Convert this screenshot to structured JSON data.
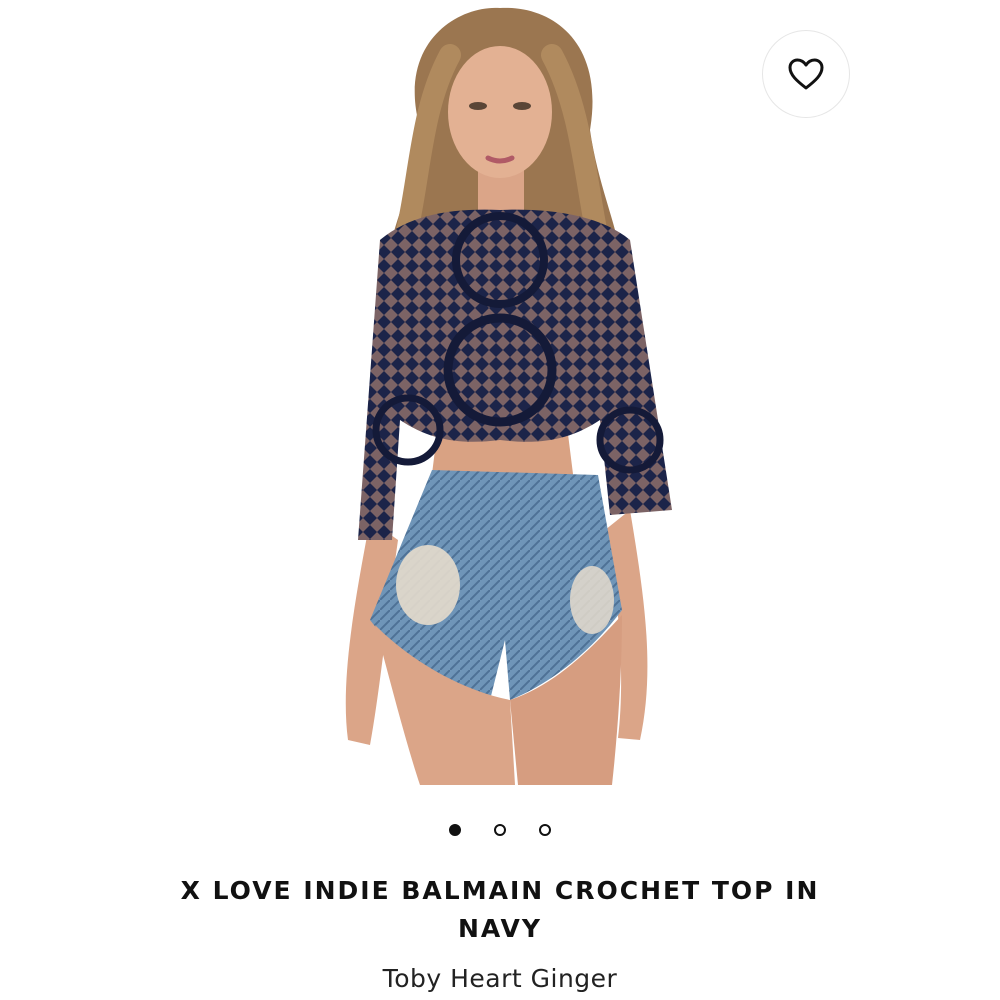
{
  "product": {
    "title": "X LOVE INDIE BALMAIN CROCHET TOP IN NAVY",
    "seller": "Toby Heart Ginger",
    "image_subject": "model wearing navy crochet crop top and distressed denim shorts"
  },
  "wishlist": {
    "icon": "heart-outline-icon"
  },
  "carousel": {
    "total_images": 3,
    "active_index": 0
  },
  "colors": {
    "top_navy": "#1c2449",
    "denim": "#6f95b8",
    "text": "#111111",
    "background": "#ffffff"
  }
}
